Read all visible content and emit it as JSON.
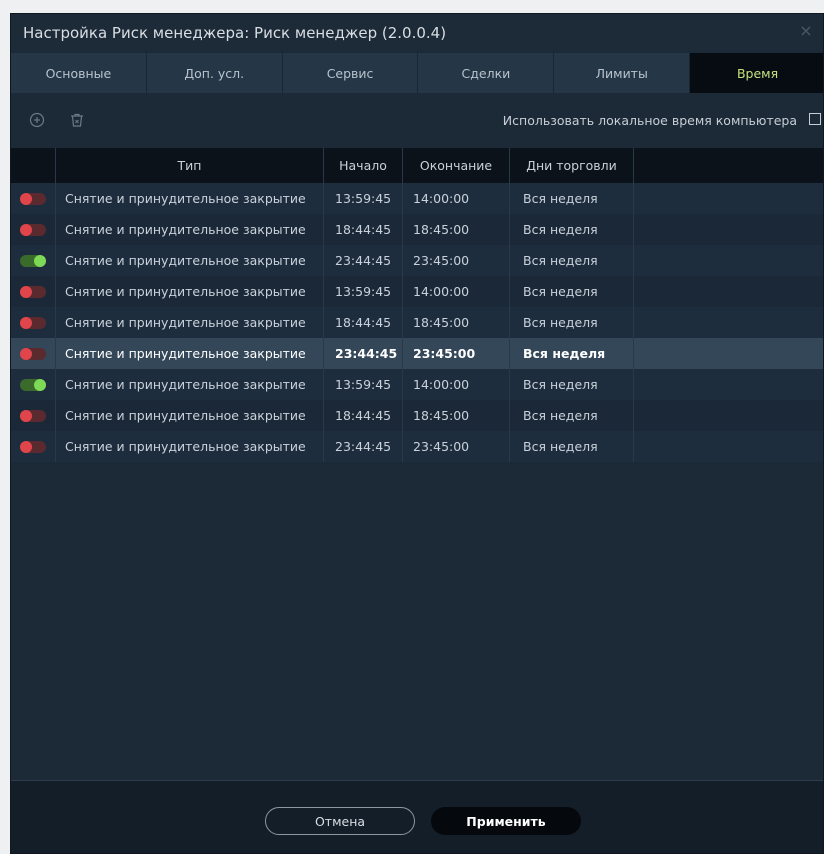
{
  "window": {
    "title": "Настройка Риск менеджера: Риск менеджер (2.0.0.4)",
    "close_glyph": "×"
  },
  "tabs": [
    {
      "label": "Основные",
      "active": false
    },
    {
      "label": "Доп. усл.",
      "active": false
    },
    {
      "label": "Сервис",
      "active": false
    },
    {
      "label": "Сделки",
      "active": false
    },
    {
      "label": "Лимиты",
      "active": false
    },
    {
      "label": "Время",
      "active": true
    }
  ],
  "toolbar": {
    "add_icon": "add-circle-icon",
    "delete_icon": "trash-icon",
    "local_time_label": "Использовать локальное время компьютера",
    "local_time_checked": false
  },
  "table": {
    "headers": {
      "type": "Тип",
      "start": "Начало",
      "end": "Окончание",
      "days": "Дни торговли"
    },
    "rows": [
      {
        "enabled": false,
        "type": "Снятие и принудительное закрытие",
        "start": "13:59:45",
        "end": "14:00:00",
        "days": "Вся неделя",
        "selected": false
      },
      {
        "enabled": false,
        "type": "Снятие и принудительное закрытие",
        "start": "18:44:45",
        "end": "18:45:00",
        "days": "Вся неделя",
        "selected": false
      },
      {
        "enabled": true,
        "type": "Снятие и принудительное закрытие",
        "start": "23:44:45",
        "end": "23:45:00",
        "days": "Вся неделя",
        "selected": false
      },
      {
        "enabled": false,
        "type": "Снятие и принудительное закрытие",
        "start": "13:59:45",
        "end": "14:00:00",
        "days": "Вся неделя",
        "selected": false
      },
      {
        "enabled": false,
        "type": "Снятие и принудительное закрытие",
        "start": "18:44:45",
        "end": "18:45:00",
        "days": "Вся неделя",
        "selected": false
      },
      {
        "enabled": false,
        "type": "Снятие и принудительное закрытие",
        "start": "23:44:45",
        "end": "23:45:00",
        "days": "Вся неделя",
        "selected": true
      },
      {
        "enabled": true,
        "type": "Снятие и принудительное закрытие",
        "start": "13:59:45",
        "end": "14:00:00",
        "days": "Вся неделя",
        "selected": false
      },
      {
        "enabled": false,
        "type": "Снятие и принудительное закрытие",
        "start": "18:44:45",
        "end": "18:45:00",
        "days": "Вся неделя",
        "selected": false
      },
      {
        "enabled": false,
        "type": "Снятие и принудительное закрытие",
        "start": "23:44:45",
        "end": "23:45:00",
        "days": "Вся неделя",
        "selected": false
      }
    ]
  },
  "footer": {
    "cancel_label": "Отмена",
    "apply_label": "Применить"
  },
  "colors": {
    "tab_active_text": "#c6e37b",
    "toggle_on_track": "#3b6b2a",
    "toggle_on_knob": "#7ed957",
    "toggle_off_track": "#5a2a2e",
    "toggle_off_knob": "#e0454c",
    "selected_row": "#334759"
  }
}
